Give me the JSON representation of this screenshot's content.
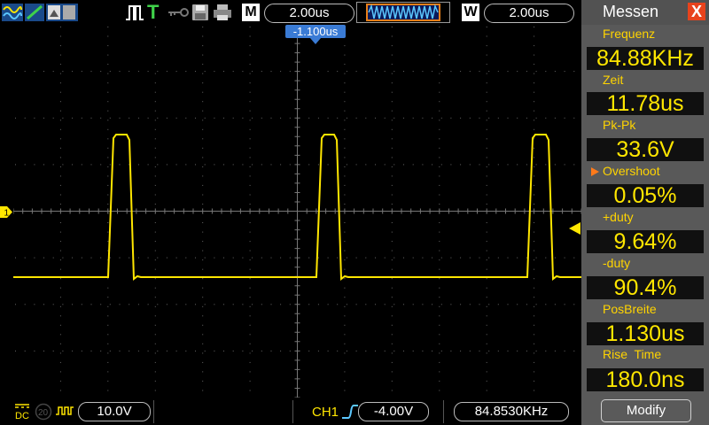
{
  "toolbar": {
    "icons": [
      "waveform-icon",
      "line-icon",
      "screenshot-icon",
      "trigger-pulse-icon",
      "trigger-T-icon",
      "key-icon",
      "save-icon",
      "print-icon"
    ],
    "trigger_letter": "T",
    "main_letter": "M",
    "main_timebase": "2.00us",
    "window_letter": "W",
    "window_timebase": "2.00us"
  },
  "screen": {
    "trigger_position": "-1.100us",
    "channel_marker": "1",
    "trace_color": "#ffe600"
  },
  "panel": {
    "title": "Messen",
    "close_label": "X",
    "measurements": [
      {
        "label": "Frequenz",
        "value": "84.88KHz"
      },
      {
        "label": "Zeit",
        "value": "11.78us"
      },
      {
        "label": "Pk-Pk",
        "value": "33.6V"
      },
      {
        "label": "Overshoot",
        "value": "0.05%",
        "selected": true
      },
      {
        "label": "+duty",
        "value": "9.64%"
      },
      {
        "label": "-duty",
        "value": "90.4%"
      },
      {
        "label": "PosBreite",
        "value": "1.130us"
      },
      {
        "label": "Rise  Time",
        "value": "180.0ns"
      }
    ],
    "modify_label": "Modify"
  },
  "status": {
    "coupling_label": "DC",
    "bw_label": "20",
    "volts_div": "10.0V",
    "channel_label": "CH1",
    "trigger_level": "-4.00V",
    "frequency": "84.8530KHz"
  }
}
